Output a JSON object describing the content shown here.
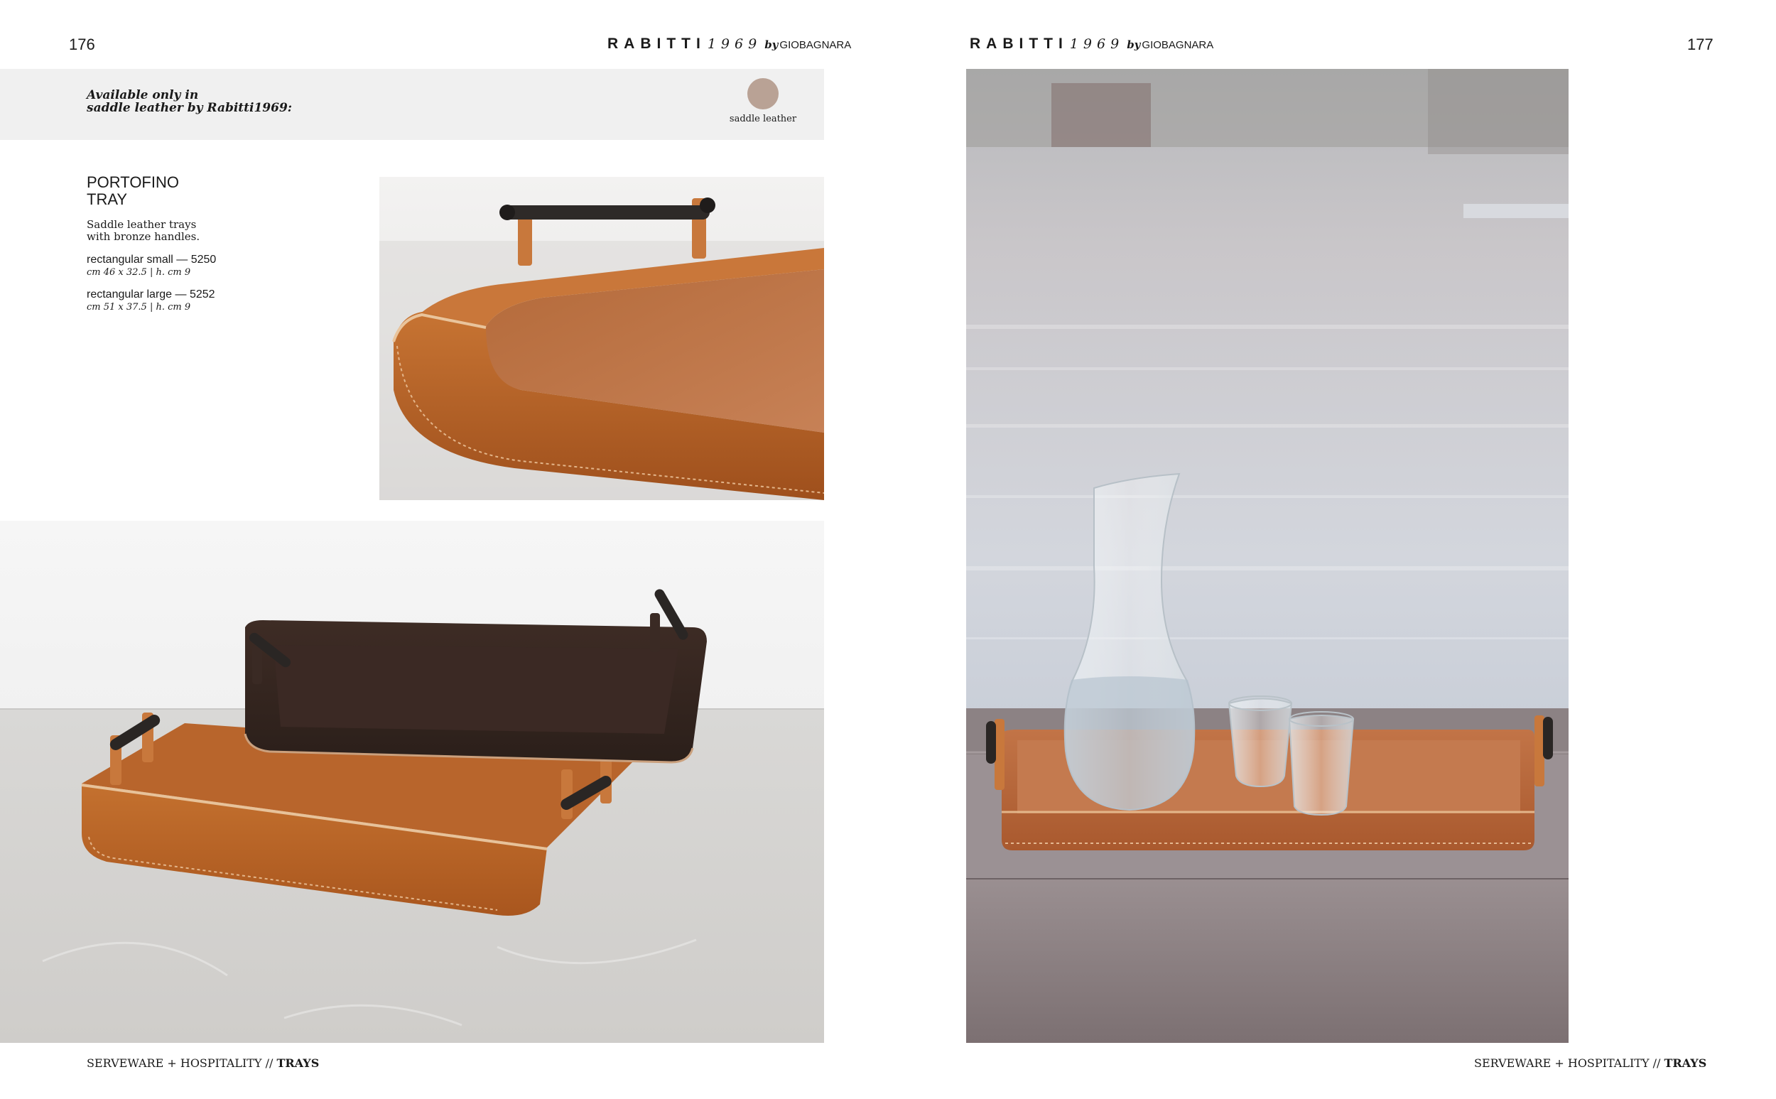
{
  "left_page": {
    "page_number": "176",
    "brand": {
      "name": "RABITTI",
      "year": "1969",
      "by": "by",
      "maker": "GIOBAGNARA"
    },
    "availability_note": "Available only in\nsaddle leather by Rabitti1969:",
    "swatch": {
      "label": "saddle leather",
      "color": "#b9a295"
    },
    "product": {
      "title_line1": "PORTOFINO",
      "title_line2": "TRAY",
      "description": "Saddle leather trays\nwith bronze handles.",
      "variants": [
        {
          "name": "rectangular small — 5250",
          "dims": "cm 46 x 32.5  |  h. cm 9"
        },
        {
          "name": "rectangular large — 5252",
          "dims": "cm 51 x 37.5  |  h. cm 9"
        }
      ]
    },
    "footer": {
      "section": "SERVEWARE + HOSPITALITY // ",
      "category": "TRAYS"
    }
  },
  "right_page": {
    "page_number": "177",
    "brand": {
      "name": "RABITTI",
      "year": "1969",
      "by": "by",
      "maker": "GIOBAGNARA"
    },
    "footer": {
      "section": "SERVEWARE + HOSPITALITY // ",
      "category": "TRAYS"
    }
  },
  "colors": {
    "saddle_leather": "#b8642a",
    "dark_leather": "#3b2a24",
    "water": "#c9ccd3",
    "granite": "#8a7e80"
  }
}
